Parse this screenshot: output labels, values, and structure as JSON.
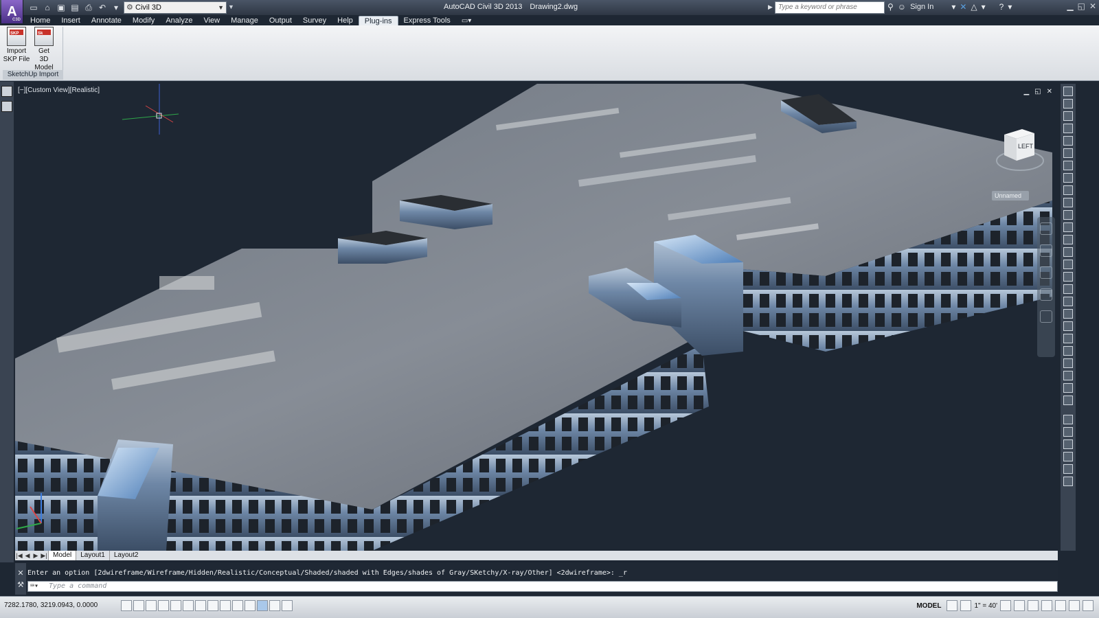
{
  "window": {
    "app_name": "AutoCAD Civil 3D 2013",
    "document": "Drawing2.dwg",
    "logo_text": "A",
    "logo_sub": "C3D"
  },
  "workspace": {
    "value": "Civil 3D"
  },
  "search": {
    "placeholder": "Type a keyword or phrase"
  },
  "account": {
    "sign_in": "Sign In"
  },
  "menu_tabs": [
    "Home",
    "Insert",
    "Annotate",
    "Modify",
    "Analyze",
    "View",
    "Manage",
    "Output",
    "Survey",
    "Help",
    "Plug-ins",
    "Express Tools"
  ],
  "active_tab": "Plug-ins",
  "ribbon": {
    "panel_title": "SketchUp Import",
    "buttons": [
      {
        "line1": "Import",
        "line2": "SKP File",
        "tag": "SKP"
      },
      {
        "line1": "Get",
        "line2": "3D Model",
        "tag": "Sk"
      }
    ]
  },
  "viewport": {
    "label": "[−][Custom View][Realistic]",
    "viewcube_face": "LEFT",
    "ucs_name": "Unnamed",
    "controls": [
      "▁",
      "◱",
      "✕"
    ]
  },
  "layout_tabs": [
    "Model",
    "Layout1",
    "Layout2"
  ],
  "active_layout": "Model",
  "command": {
    "history": "Enter an option [2dwireframe/Wireframe/Hidden/Realistic/Conceptual/Shaded/shaded with Edges/shades of Gray/SKetchy/X-ray/Other] <2dwireframe>: _r",
    "placeholder": "Type a command"
  },
  "status": {
    "coords": "7282.1780, 3219.0943, 0.0000",
    "space": "MODEL",
    "scale": "1\" = 40'"
  },
  "colors": {
    "viewport_bg": "#1e2733",
    "roof": "#7b818b",
    "facade": "#8ea3bd",
    "active_tab_bg": "#e9edf2"
  }
}
